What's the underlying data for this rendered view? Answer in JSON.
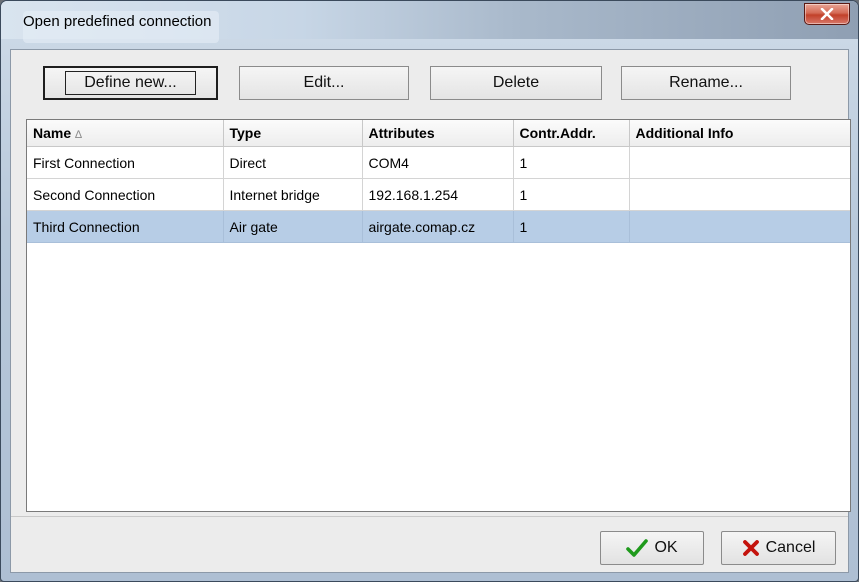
{
  "window": {
    "title": "Open predefined connection",
    "close_symbol": "✕"
  },
  "toolbar": {
    "define_new_label": "Define new...",
    "edit_label": "Edit...",
    "delete_label": "Delete",
    "rename_label": "Rename..."
  },
  "table": {
    "sort_indicator": "∆",
    "columns": [
      "Name",
      "Type",
      "Attributes",
      "Contr.Addr.",
      "Additional Info"
    ],
    "rows": [
      [
        "First Connection",
        "Direct",
        "COM4",
        "1",
        ""
      ],
      [
        "Second Connection",
        "Internet bridge",
        "192.168.1.254",
        "1",
        ""
      ],
      [
        "Third Connection",
        "Air gate",
        "airgate.comap.cz",
        "1",
        ""
      ]
    ],
    "selected_row": 2
  },
  "footer": {
    "ok_label": "OK",
    "cancel_label": "Cancel",
    "ok_icon": "checkmark-icon",
    "cancel_icon": "x-icon"
  },
  "colors": {
    "selection": "#b7cde6",
    "ok_icon": "#1f9a1c",
    "cancel_icon": "#c4130d",
    "close_button": "#c2412a"
  }
}
